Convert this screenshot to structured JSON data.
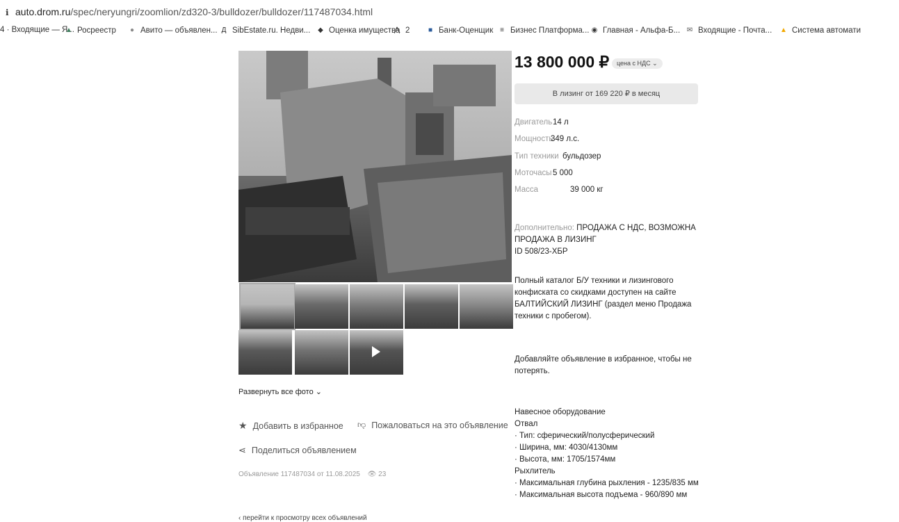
{
  "browser": {
    "url_host": "auto.drom.ru",
    "url_path": "/spec/neryungri/zoomlion/zd320-3/bulldozer/bulldozer/117487034.html",
    "bookmarks": [
      {
        "label": "4 · Входящие — Я...",
        "icon": "mail-icon",
        "color": "#444444"
      },
      {
        "label": "Росреестр",
        "icon": "emblem-icon",
        "color": "#3f7f5f"
      },
      {
        "label": "Авито — объявлен...",
        "icon": "avito-icon",
        "color": "#8a8a8a"
      },
      {
        "label": "SibEstate.ru. Недви...",
        "icon": "dc-icon",
        "color": "#222222"
      },
      {
        "label": "Оценка имущества",
        "icon": "diamond-icon",
        "color": "#333333"
      },
      {
        "label": "2",
        "icon": "chart-icon",
        "color": "#333333"
      },
      {
        "label": "Банк-Оценщик",
        "icon": "bank-icon",
        "color": "#2b5b9b"
      },
      {
        "label": "Бизнес Платформа...",
        "icon": "lines-icon",
        "color": "#333333"
      },
      {
        "label": "Главная - Альфа-Б...",
        "icon": "globe-icon",
        "color": "#333333"
      },
      {
        "label": "Входящие - Почта...",
        "icon": "mailbox-icon",
        "color": "#555555"
      },
      {
        "label": "Система автомати",
        "icon": "system-icon",
        "color": "#f2a900"
      }
    ]
  },
  "gallery": {
    "expand_label": "Развернуть все фото",
    "thumbnails_count": 8,
    "has_video": true
  },
  "actions": {
    "favorite": "Добавить в избранное",
    "complain": "Пожаловаться на это объявление",
    "share": "Поделиться объявлением",
    "ad_info": "Объявление 117487034 от 11.08.2025",
    "views": "23",
    "back_link": "перейти к просмотру всех объявлений"
  },
  "listing": {
    "price": "13 800 000 ₽",
    "vat_badge": "цена с НДС",
    "lease_button": "В лизинг от 169 220 ₽ в месяц",
    "specs": [
      {
        "key": "Двигатель",
        "value": "14 л"
      },
      {
        "key": "Мощность",
        "value": "349 л.с."
      },
      {
        "key": "Тип техники",
        "value": "бульдозер"
      },
      {
        "key": "Моточасы",
        "value": "5 000"
      },
      {
        "key": "Масса",
        "value": "39 000 кг"
      }
    ],
    "extra_label": "Дополнительно:",
    "extra_text": "ПРОДАЖА С НДС, ВОЗМОЖНА ПРОДАЖА В ЛИЗИНГ",
    "id_line": "ID 508/23-ХБР",
    "catalog_text": "Полный каталог Б/У техники и лизингового конфиската со скидками доступен на сайте БАЛТИЙСКИЙ ЛИЗИНГ (раздел меню Продажа техники с пробегом).",
    "favorite_hint": "Добавляйте объявление в избранное, чтобы не потерять.",
    "equipment_lines": [
      "Навесное оборудование",
      "Отвал",
      "· Тип: сферический/полусферический",
      "· Ширина, мм: 4030/4130мм",
      "· Высота, мм: 1705/1574мм",
      "Рыхлитель",
      "· Максимальная глубина рыхления - 1235/835 мм",
      "· Максимальная высота подъема - 960/890 мм"
    ]
  }
}
